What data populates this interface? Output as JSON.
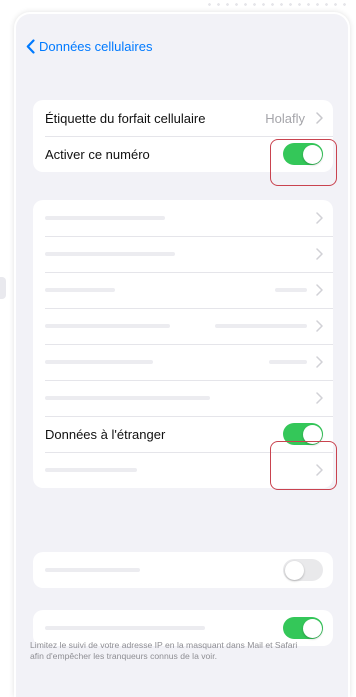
{
  "nav": {
    "back_label": "Données cellulaires"
  },
  "section1": {
    "plan_label": {
      "label": "Étiquette du forfait cellulaire",
      "value": "Holafly"
    },
    "activate_number": {
      "label": "Activer ce numéro",
      "enabled": true
    }
  },
  "section2": {
    "roaming": {
      "label": "Données à l'étranger",
      "enabled": true
    }
  },
  "section3": {
    "toggle_enabled": false
  },
  "section4": {
    "toggle_enabled": true
  },
  "footer_text": "Limitez le suivi de votre adresse IP en la masquant dans Mail et Safari afin d'empêcher les tranqueurs connus de la voir.",
  "colors": {
    "accent": "#007aff",
    "toggle_on": "#34c759",
    "toggle_off": "#e9e9eb",
    "highlight": "#c9434f",
    "background": "#f2f2f7"
  }
}
